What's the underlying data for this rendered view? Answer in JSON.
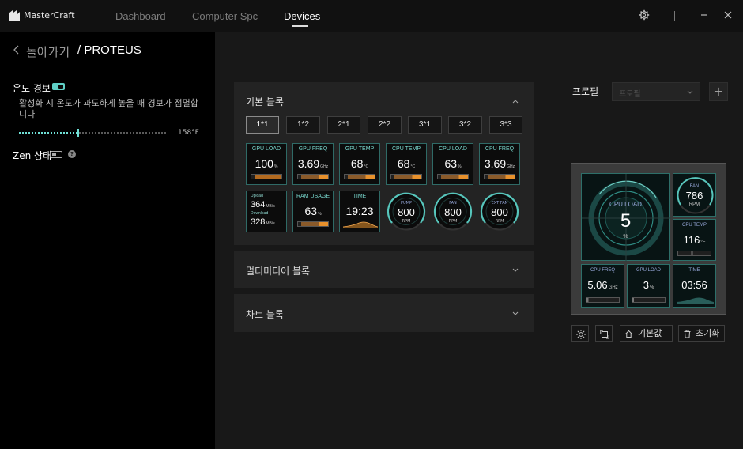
{
  "app": {
    "name": "MasterCraft",
    "tabs": [
      {
        "label": "Dashboard",
        "active": false
      },
      {
        "label": "Computer Spc",
        "active": false
      },
      {
        "label": "Devices",
        "active": true
      }
    ]
  },
  "sidebar": {
    "back_label": "돌아가기",
    "separator": "/",
    "device_name": "PROTEUS",
    "temp_alert": {
      "label": "온도 경보",
      "enabled": true,
      "description": "활성화 시 온도가 과도하게 높을 때 경보가 점멸합니다",
      "slider_value": "158°F"
    },
    "zen": {
      "label": "Zen 상태",
      "enabled": false,
      "help": "?"
    }
  },
  "basic_block": {
    "title": "기본 블록",
    "sizes": [
      "1*1",
      "1*2",
      "2*1",
      "2*2",
      "3*1",
      "3*2",
      "3*3"
    ],
    "selected_size": "1*1",
    "tiles_row1": [
      {
        "label": "GPU LOAD",
        "value": "100",
        "unit": "%"
      },
      {
        "label": "GPU FREQ",
        "value": "3.69",
        "unit": "GHz"
      },
      {
        "label": "GPU TEMP",
        "value": "68",
        "unit": "°C"
      },
      {
        "label": "CPU TEMP",
        "value": "68",
        "unit": "°C"
      },
      {
        "label": "CPU LOAD",
        "value": "63",
        "unit": "%"
      },
      {
        "label": "CPU FREQ",
        "value": "3.69",
        "unit": "GHz"
      }
    ],
    "network": {
      "upload_label": "Upload",
      "upload_value": "364",
      "upload_unit": "MB/s",
      "download_label": "Download",
      "download_value": "328",
      "download_unit": "MB/s"
    },
    "ram": {
      "label": "RAM USAGE",
      "value": "63",
      "unit": "%"
    },
    "time": {
      "label": "TIME",
      "value": "19:23"
    },
    "gauges": [
      {
        "label": "PUMP",
        "value": "800",
        "unit": "RPM"
      },
      {
        "label": "FAN",
        "value": "800",
        "unit": "RPM"
      },
      {
        "label": "EXT FAN",
        "value": "800",
        "unit": "RPM"
      }
    ]
  },
  "multimedia_block": {
    "title": "멀티미디어 블록"
  },
  "chart_block": {
    "title": "차트 블록"
  },
  "profile": {
    "label": "프로필",
    "placeholder": "프로필",
    "add": "+"
  },
  "preview": {
    "cpu_load": {
      "label": "CPU LOAD",
      "value": "5",
      "unit": "%"
    },
    "fan": {
      "label": "FAN",
      "value": "786",
      "unit": "RPM"
    },
    "cpu_temp": {
      "label": "CPU TEMP",
      "value": "116",
      "unit": "°F"
    },
    "cpu_freq": {
      "label": "CPU FREQ",
      "value": "5.06",
      "unit": "GHz"
    },
    "gpu_load": {
      "label": "GPU LOAD",
      "value": "3",
      "unit": "%"
    },
    "time": {
      "label": "TIME",
      "value": "03:56"
    }
  },
  "toolbar": {
    "default_label": "기본값",
    "reset_label": "초기화"
  },
  "colors": {
    "accent": "#5fd0c6",
    "panel": "#232323",
    "bar": "#e8912c"
  }
}
